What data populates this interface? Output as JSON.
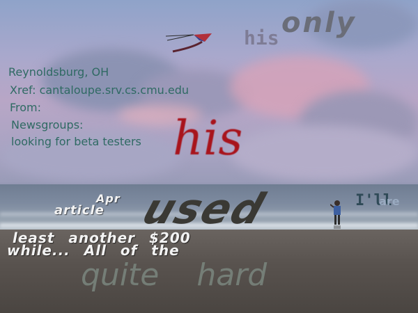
{
  "text_lines": [
    "Reynoldsburg, OH",
    "Xref: cantaloupe.srv.cs.cmu.edu",
    "From:",
    "Newsgroups:",
    "looking for beta testers"
  ],
  "words": {
    "his_top": "his",
    "only": "only",
    "his_red": "his",
    "apr": "Apr",
    "article": "article",
    "used": "used",
    "ill": "I'll",
    "are": "are",
    "least_line": "least another $200",
    "while_line": "while... All of the",
    "quite_hard": "quite hard"
  },
  "colors": {
    "teal_text": "#2f6a63",
    "red_text": "#a8141c",
    "gray_text": "#6b6b78"
  }
}
